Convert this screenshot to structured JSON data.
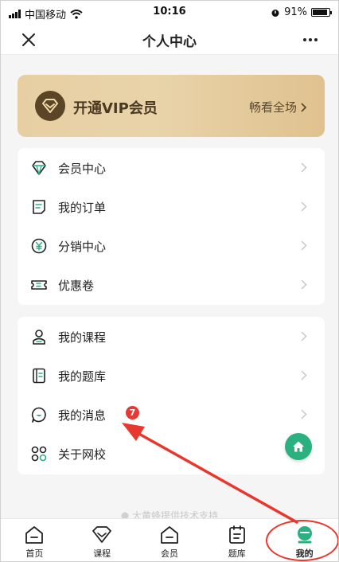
{
  "status_bar": {
    "carrier": "中国移动",
    "time": "10:16",
    "battery": "91%",
    "battery_level": 0.91
  },
  "nav": {
    "title": "个人中心",
    "close_icon": "close-icon",
    "more_icon": "more-icon"
  },
  "vip": {
    "title": "开通VIP会员",
    "action": "畅看全场",
    "colors": {
      "card_start": "#e7cfa3",
      "card_end": "#dfc28f",
      "badge": "#5a4526"
    }
  },
  "menu_group_1": [
    {
      "label": "会员中心",
      "icon": "diamond-icon"
    },
    {
      "label": "我的订单",
      "icon": "order-icon"
    },
    {
      "label": "分销中心",
      "icon": "yen-icon"
    },
    {
      "label": "优惠卷",
      "icon": "coupon-icon"
    }
  ],
  "menu_group_2": [
    {
      "label": "我的课程",
      "icon": "course-icon"
    },
    {
      "label": "我的题库",
      "icon": "question-bank-icon"
    },
    {
      "label": "我的消息",
      "icon": "message-icon",
      "badge": "7"
    },
    {
      "label": "关于网校",
      "icon": "apps-icon"
    }
  ],
  "footer": {
    "text": "大黄蜂提供技术支持"
  },
  "tabs": [
    {
      "label": "首页",
      "icon": "home-tab-icon",
      "active": false
    },
    {
      "label": "课程",
      "icon": "course-tab-icon",
      "active": false
    },
    {
      "label": "会员",
      "icon": "member-tab-icon",
      "active": false
    },
    {
      "label": "题库",
      "icon": "question-bank-tab-icon",
      "active": false
    },
    {
      "label": "我的",
      "icon": "profile-tab-icon",
      "active": true
    }
  ],
  "colors": {
    "accent": "#2bb07f",
    "badge": "#e53935",
    "annotation": "#e8382e"
  }
}
